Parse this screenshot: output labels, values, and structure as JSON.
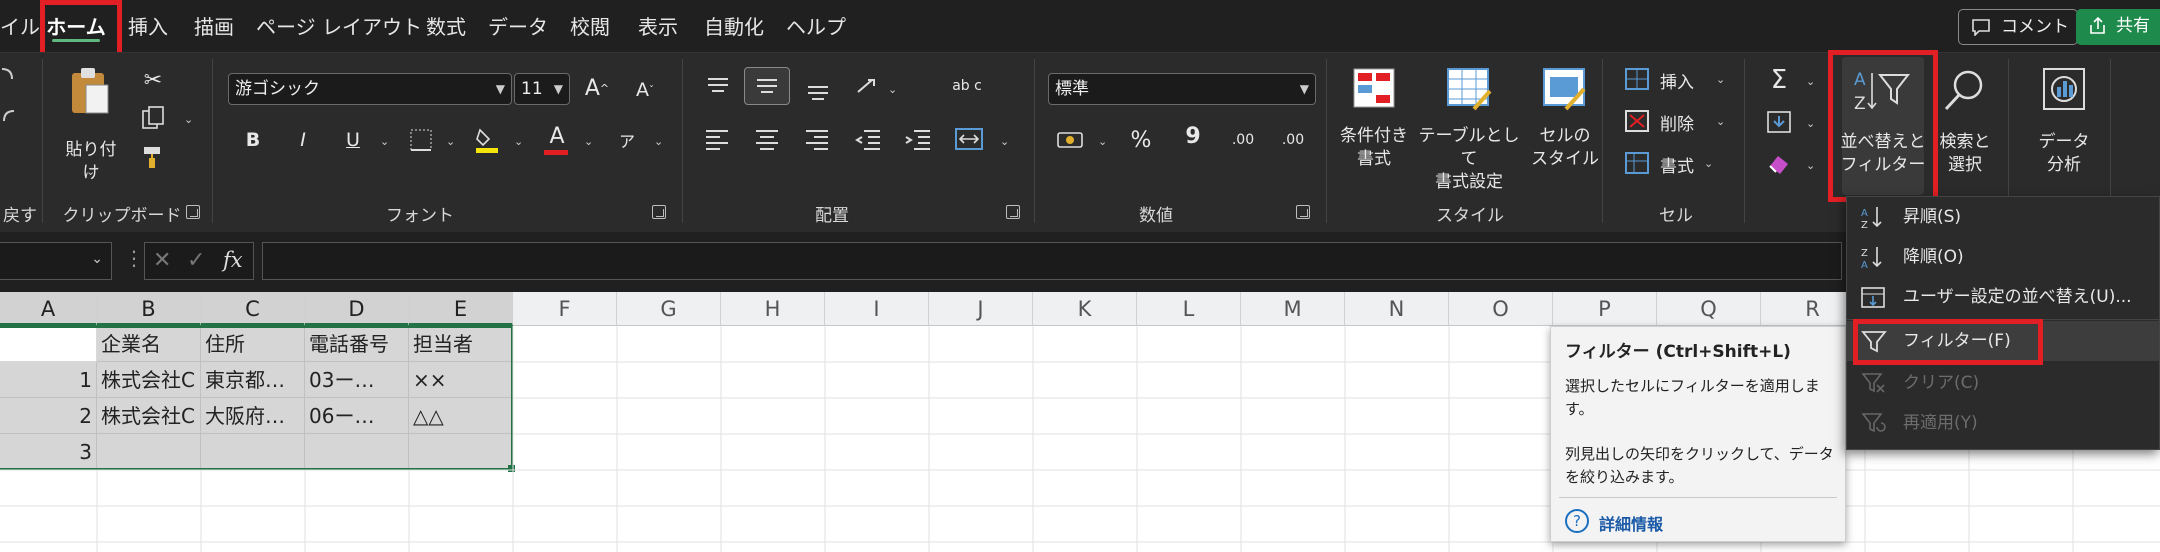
{
  "menu": {
    "tabs": [
      "イル",
      "ホーム",
      "挿入",
      "描画",
      "ページ レイアウト",
      "数式",
      "データ",
      "校閲",
      "表示",
      "自動化",
      "ヘルプ"
    ],
    "comment_label": "コメント",
    "share_label": "共有"
  },
  "ribbon": {
    "undo": {
      "label": "戻す"
    },
    "clipboard": {
      "paste_label": "貼り付け",
      "group_label": "クリップボード"
    },
    "font": {
      "font_name": "游ゴシック",
      "font_size": "11",
      "bold": "B",
      "italic": "I",
      "underline": "U",
      "grow": "A",
      "shrink": "A",
      "color_a": "A",
      "phonetic": "ア",
      "group_label": "フォント"
    },
    "alignment": {
      "group_label": "配置",
      "wrap": "ab c"
    },
    "number": {
      "format": "標準",
      "percent": "%",
      "comma": "9",
      "inc": ".00",
      "dec": ".00",
      "group_label": "数値"
    },
    "styles": {
      "conditional": "条件付き\n書式",
      "table": "テーブルとして\n書式設定",
      "cell_styles": "セルの\nスタイル",
      "group_label": "スタイル"
    },
    "cells": {
      "insert": "挿入",
      "delete": "削除",
      "format": "書式",
      "group_label": "セル"
    },
    "editing": {
      "sort_filter": "並べ替えと\nフィルター",
      "find_select": "検索と\n選択",
      "sigma": "Σ"
    },
    "analysis": {
      "data_analysis": "データ\n分析"
    }
  },
  "formula_bar": {
    "fx": "fx",
    "cancel": "✕",
    "enter": "✓",
    "value": ""
  },
  "grid": {
    "columns": [
      "A",
      "B",
      "C",
      "D",
      "E",
      "F",
      "G",
      "H",
      "I",
      "J",
      "K",
      "L",
      "M",
      "N",
      "O",
      "P",
      "Q",
      "R"
    ],
    "rows": [
      [
        "",
        "企業名",
        "住所",
        "電話番号",
        "担当者"
      ],
      [
        "1",
        "株式会社C",
        "東京都…",
        "03ー…",
        "××"
      ],
      [
        "2",
        "株式会社C",
        "大阪府…",
        "06ー…",
        "△△"
      ],
      [
        "3",
        "",
        "",
        "",
        ""
      ]
    ]
  },
  "tooltip": {
    "title": "フィルター (Ctrl+Shift+L)",
    "desc1": "選択したセルにフィルターを適用しま\nす。",
    "desc2": "列見出しの矢印をクリックして、データ\nを絞り込みます。",
    "more": "詳細情報"
  },
  "dropdown": {
    "items": [
      {
        "label": "昇順(S)",
        "icon": "sort-ascending-icon",
        "enabled": true
      },
      {
        "label": "降順(O)",
        "icon": "sort-descending-icon",
        "enabled": true
      },
      {
        "label": "ユーザー設定の並べ替え(U)...",
        "icon": "custom-sort-icon",
        "enabled": true
      },
      {
        "label": "フィルター(F)",
        "icon": "filter-icon",
        "enabled": true
      },
      {
        "label": "クリア(C)",
        "icon": "clear-filter-icon",
        "enabled": false
      },
      {
        "label": "再適用(Y)",
        "icon": "reapply-icon",
        "enabled": false
      }
    ]
  },
  "colors": {
    "highlight": "#e11f24",
    "accent_green": "#217346",
    "share_bg": "#1e8a4c"
  }
}
